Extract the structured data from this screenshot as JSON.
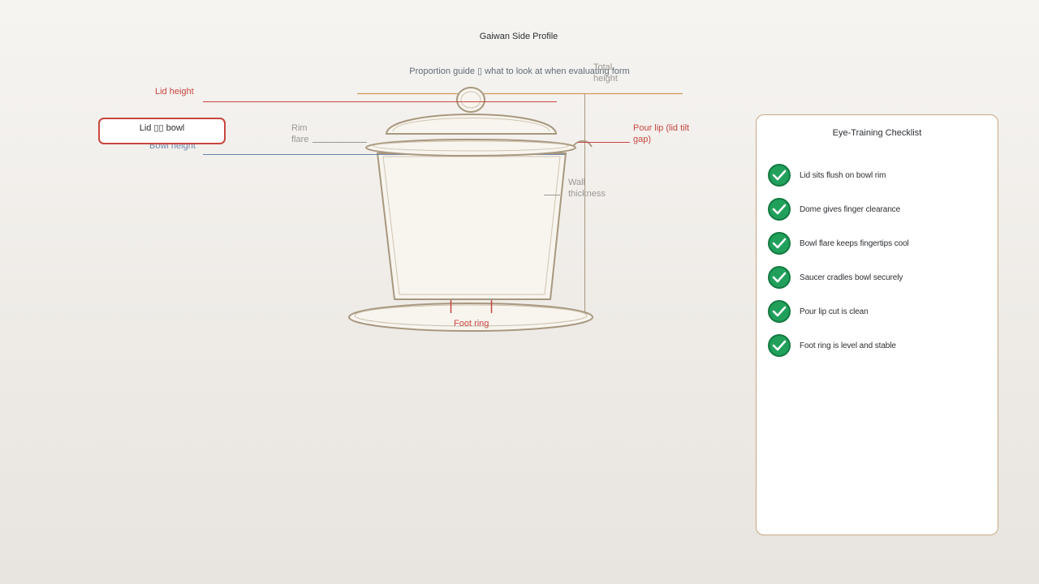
{
  "diagram": {
    "title": "Gaiwan Side Profile",
    "subtitle": "Proportion guide ▯ what to look at when evaluating form",
    "labels": {
      "total_height": "Total height",
      "lid_height": "Lid height",
      "bowl_height": "Bowl height",
      "rim_flare": "Rim flare",
      "pour_lip": "Pour lip (lid tilt gap)",
      "wall_thickness": "Wall thickness",
      "foot_ring": "Foot ring"
    },
    "tooltip": "Lid ▯▯ bowl"
  },
  "checklist": {
    "title": "Eye-Training Checklist",
    "items": [
      {
        "label": "Lid sits flush on bowl rim",
        "checked": true
      },
      {
        "label": "Dome gives finger clearance",
        "checked": true
      },
      {
        "label": "Bowl flare keeps fingertips cool",
        "checked": true
      },
      {
        "label": "Saucer cradles bowl securely",
        "checked": true
      },
      {
        "label": "Pour lip cut is clean",
        "checked": true
      },
      {
        "label": "Foot ring is level and stable",
        "checked": true
      }
    ]
  },
  "colors": {
    "accent_red": "#c8473f",
    "accent_blue": "#6d86ad",
    "accent_orange": "#d09a5e",
    "porcelain_outline": "#a8987e",
    "porcelain_fill": "#f8f5ef",
    "check_green": "#20a05b"
  }
}
